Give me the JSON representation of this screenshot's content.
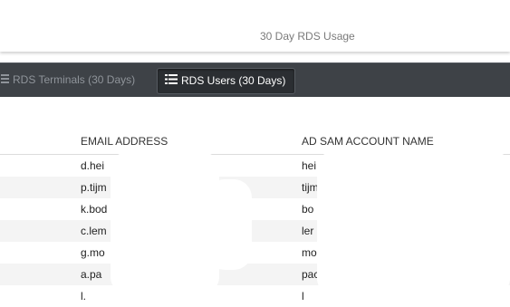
{
  "header": {
    "title": "30 Day RDS Usage"
  },
  "toolbar": {
    "tabs": [
      {
        "label": "RDS Terminals (30 Days)",
        "icon": "list-icon",
        "active": false
      },
      {
        "label": "RDS Users (30 Days)",
        "icon": "list-icon",
        "active": true
      }
    ]
  },
  "table": {
    "columns": [
      "EMAIL ADDRESS",
      "AD SAM ACCOUNT NAME"
    ],
    "rows": [
      {
        "email": "d.hei",
        "ad": "hei"
      },
      {
        "email": "p.tijm",
        "ad": "tijm"
      },
      {
        "email": "k.bod",
        "ad": "bo"
      },
      {
        "email": "c.lem",
        "ad": "ler"
      },
      {
        "email": "g.mo",
        "ad": "mo"
      },
      {
        "email": "a.pa",
        "ad": "pac"
      },
      {
        "email": "l.",
        "ad": "l"
      }
    ]
  },
  "colors": {
    "toolbar": "#3e4247",
    "active_tab": "#2b2e32",
    "row_stripe": "#f4f4f4"
  }
}
